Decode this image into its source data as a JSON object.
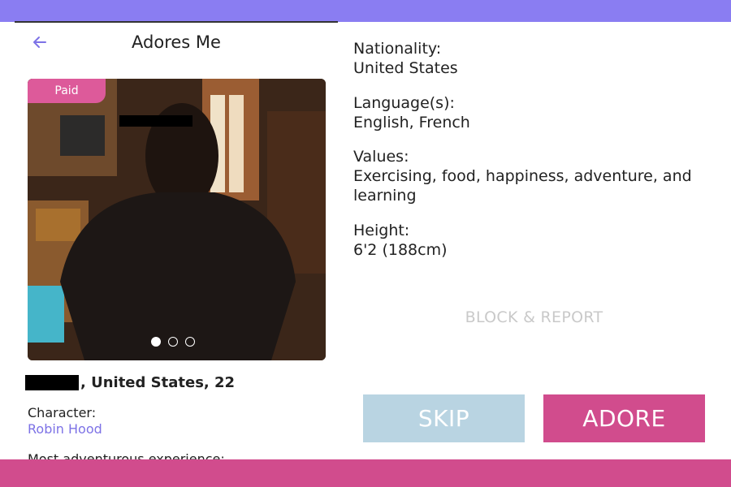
{
  "colors": {
    "top_band": "#8a7df2",
    "bottom_band": "#d14c8d",
    "accent": "#7d72e6",
    "adore": "#d14c8d",
    "skip": "#b9d4e2"
  },
  "header": {
    "back_icon": "back-arrow-icon",
    "title": "Adores Me"
  },
  "profile": {
    "badge": "Paid",
    "photo_pages": 3,
    "photo_active_index": 0,
    "name_suffix": ", United States, 22",
    "character_label": "Character:",
    "character_value": "Robin Hood",
    "adventure_label": "Most adventurous experience:"
  },
  "details": [
    {
      "label": "Nationality:",
      "value": "United States"
    },
    {
      "label": "Language(s):",
      "value": "English, French"
    },
    {
      "label": "Values:",
      "value": "Exercising, food, happiness, adventure, and learning"
    },
    {
      "label": "Height:",
      "value": "6'2 (188cm)"
    }
  ],
  "actions": {
    "block_report": "BLOCK & REPORT",
    "skip": "SKIP",
    "adore": "ADORE"
  }
}
